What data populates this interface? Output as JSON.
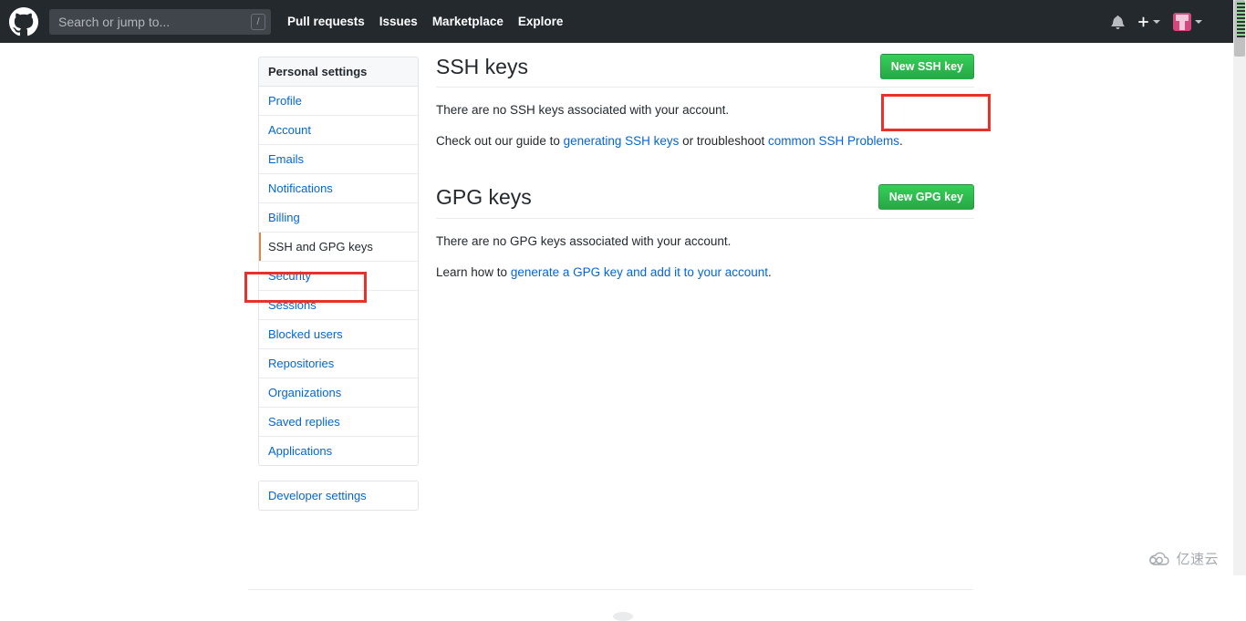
{
  "header": {
    "logo_icon": "github-mark-icon",
    "search": {
      "placeholder": "Search or jump to...",
      "value": "",
      "shortcut_badge": "/"
    },
    "nav": [
      {
        "label": "Pull requests"
      },
      {
        "label": "Issues"
      },
      {
        "label": "Marketplace"
      },
      {
        "label": "Explore"
      }
    ],
    "right": {
      "notifications_icon": "bell-icon",
      "create_new_icon": "plus-icon",
      "create_new_caret": "chevron-down-icon",
      "avatar_icon": "user-avatar",
      "avatar_caret": "chevron-down-icon"
    },
    "background_color": "#24292e"
  },
  "sidebar": {
    "heading": "Personal settings",
    "items": [
      {
        "label": "Profile",
        "selected": false
      },
      {
        "label": "Account",
        "selected": false
      },
      {
        "label": "Emails",
        "selected": false
      },
      {
        "label": "Notifications",
        "selected": false
      },
      {
        "label": "Billing",
        "selected": false
      },
      {
        "label": "SSH and GPG keys",
        "selected": true
      },
      {
        "label": "Security",
        "selected": false
      },
      {
        "label": "Sessions",
        "selected": false
      },
      {
        "label": "Blocked users",
        "selected": false
      },
      {
        "label": "Repositories",
        "selected": false
      },
      {
        "label": "Organizations",
        "selected": false
      },
      {
        "label": "Saved replies",
        "selected": false
      },
      {
        "label": "Applications",
        "selected": false
      }
    ],
    "developer_settings": "Developer settings"
  },
  "main": {
    "ssh": {
      "title": "SSH keys",
      "button_label": "New SSH key",
      "empty_text": "There are no SSH keys associated with your account.",
      "help_prefix": "Check out our guide to ",
      "help_link_1": "generating SSH keys",
      "help_middle": " or troubleshoot ",
      "help_link_2": "common SSH Problems",
      "help_suffix": "."
    },
    "gpg": {
      "title": "GPG keys",
      "button_label": "New GPG key",
      "empty_text": "There are no GPG keys associated with your account.",
      "help_prefix": "Learn how to ",
      "help_link_1": "generate a GPG key and add it to your account",
      "help_suffix": "."
    }
  },
  "annotations": [
    {
      "name": "sidebar-ssh-gpg-highlight",
      "color": "#e8312a"
    },
    {
      "name": "new-ssh-key-highlight",
      "color": "#e8312a"
    }
  ],
  "watermark": {
    "text": "亿速云",
    "icon": "cloud-icon"
  },
  "colors": {
    "accent_link": "#0366d6",
    "button_green": "#28a745",
    "header_dark": "#24292e",
    "annotation_red": "#e8312a"
  }
}
